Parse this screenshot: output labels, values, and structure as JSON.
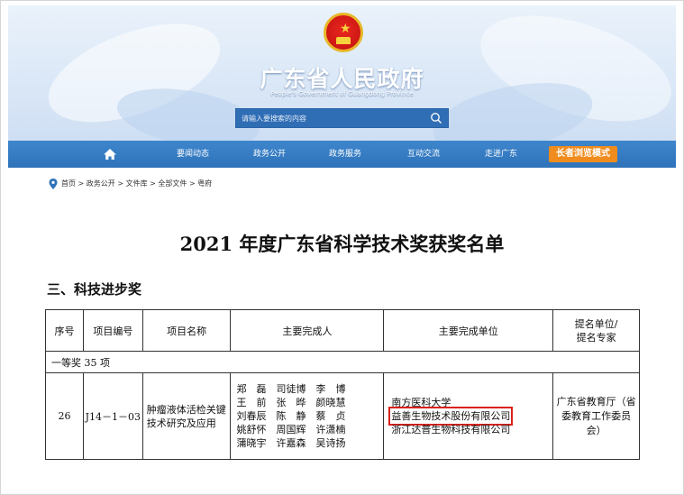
{
  "site": {
    "title": "广东省人民政府",
    "subtitle": "People's Government of Guangdong Province",
    "search_placeholder": "请输入要搜索的内容"
  },
  "nav": {
    "items": [
      "要闻动态",
      "政务公开",
      "政务服务",
      "互动交流",
      "走进广东"
    ],
    "senior_mode": "长者浏览模式"
  },
  "breadcrumb": [
    "首页",
    "政务公开",
    "文件库",
    "全部文件",
    "粤府"
  ],
  "document": {
    "title": "2021 年度广东省科学技术奖获奖名单",
    "section": "三、科技进步奖"
  },
  "table": {
    "headers": [
      "序号",
      "项目编号",
      "项目名称",
      "主要完成人",
      "主要完成单位",
      "提名单位/\n提名专家"
    ],
    "group_label": "一等奖 35 项",
    "row": {
      "no": "26",
      "code": "J14－1－03",
      "name": "肿瘤液体活检关键技术研究及应用",
      "persons": "郑　磊　司徒博　李　博\n王　前　张　晔　颜晓慧\n刘春辰　陈　静　蔡　贞\n姚舒怀　周国辉　许潇楠\n蒲晓宇　许嘉森　吴诗扬",
      "units": [
        "南方医科大学",
        "益善生物技术股份有限公司",
        "浙江达普生物科技有限公司"
      ],
      "nominator": "广东省教育厅（省委教育工作委员会）"
    }
  },
  "colors": {
    "nav_blue": "#2f73ba",
    "senior_orange": "#f08c1e",
    "highlight_red": "#d9221c"
  },
  "icons": [
    "national-emblem-icon",
    "search-icon",
    "home-icon",
    "location-pin-icon"
  ]
}
